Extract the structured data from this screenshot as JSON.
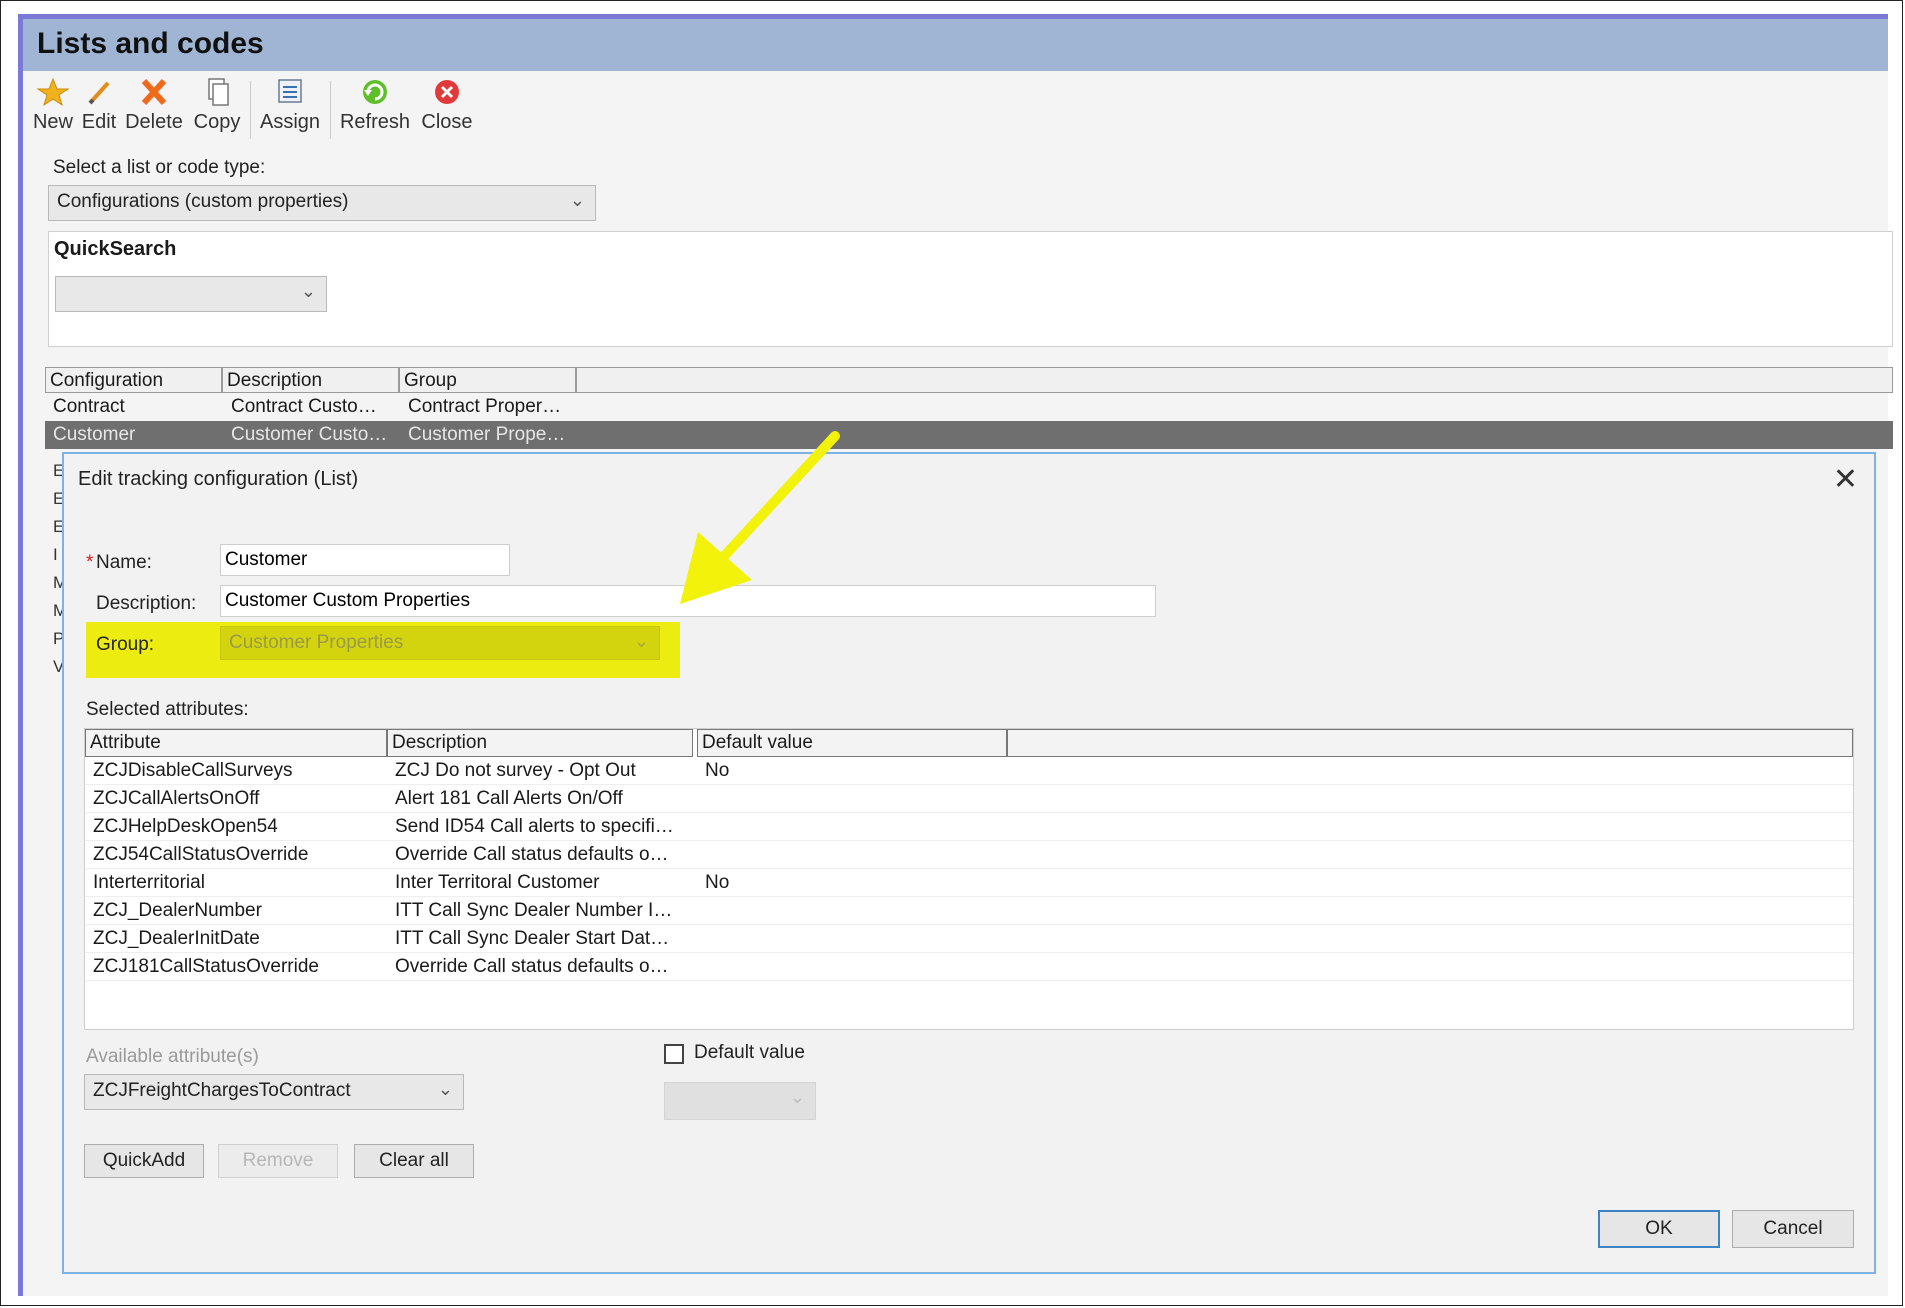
{
  "window": {
    "title": "Lists and codes"
  },
  "toolbar": {
    "new_label": "New",
    "edit_label": "Edit",
    "delete_label": "Delete",
    "copy_label": "Copy",
    "assign_label": "Assign",
    "refresh_label": "Refresh",
    "close_label": "Close"
  },
  "type_select": {
    "label": "Select a list or code type:",
    "value": "Configurations (custom properties)"
  },
  "quicksearch": {
    "title": "QuickSearch",
    "value": ""
  },
  "main_grid": {
    "headers": [
      "Configuration",
      "Description",
      "Group"
    ],
    "rows": [
      {
        "configuration": "Contract",
        "description": "Contract Custo…",
        "group": "Contract Proper…"
      },
      {
        "configuration": "Customer",
        "description": "Customer Custo…",
        "group": "Customer Prope…"
      }
    ],
    "partial_letters": [
      "E",
      "E",
      "E",
      "I",
      "M",
      "M",
      "P",
      "V"
    ]
  },
  "dialog": {
    "title": "Edit tracking configuration (List)",
    "required_mark": "*",
    "name_label": "Name:",
    "name_value": "Customer",
    "description_label": "Description:",
    "description_value": "Customer Custom Properties",
    "group_label": "Group:",
    "group_value": "Customer Properties",
    "selected_label": "Selected attributes:",
    "attr_headers": [
      "Attribute",
      "Description",
      "Default value"
    ],
    "attributes": [
      {
        "attribute": "ZCJDisableCallSurveys",
        "description": "ZCJ Do not survey - Opt Out",
        "default": "No"
      },
      {
        "attribute": "ZCJCallAlertsOnOff",
        "description": "Alert 181 Call Alerts On/Off",
        "default": ""
      },
      {
        "attribute": "ZCJHelpDeskOpen54",
        "description": "Send ID54 Call alerts to specifi…",
        "default": ""
      },
      {
        "attribute": "ZCJ54CallStatusOverride",
        "description": "Override Call status defaults o…",
        "default": ""
      },
      {
        "attribute": "Interterritorial",
        "description": "Inter Territoral Customer",
        "default": "No"
      },
      {
        "attribute": "ZCJ_DealerNumber",
        "description": "ITT Call Sync Dealer Number I…",
        "default": ""
      },
      {
        "attribute": "ZCJ_DealerInitDate",
        "description": "ITT Call Sync Dealer Start Dat…",
        "default": ""
      },
      {
        "attribute": "ZCJ181CallStatusOverride",
        "description": "Override Call status defaults o…",
        "default": ""
      }
    ],
    "available_label": "Available attribute(s)",
    "available_value": "ZCJFreightChargesToContract",
    "default_value_label": "Default value",
    "default_value_checked": false,
    "quickadd_label": "QuickAdd",
    "remove_label": "Remove",
    "clearall_label": "Clear all",
    "ok_label": "OK",
    "cancel_label": "Cancel"
  },
  "colors": {
    "title_bar": "#9fb5d3",
    "highlight": "#ecec10",
    "arrow": "#f2f20a",
    "selection": "#6f6f6f"
  }
}
